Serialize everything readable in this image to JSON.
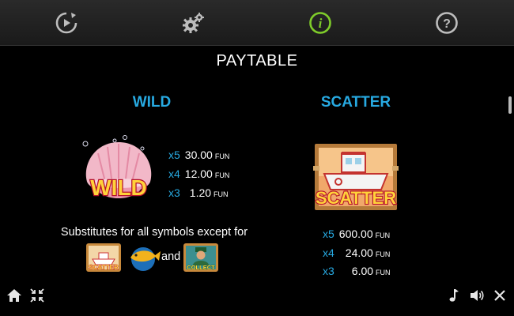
{
  "tabs": [
    {
      "name": "autoplay-icon",
      "active": false
    },
    {
      "name": "settings-icon",
      "active": false
    },
    {
      "name": "info-icon",
      "active": true
    },
    {
      "name": "help-icon",
      "active": false
    }
  ],
  "page_title": "PAYTABLE",
  "wild": {
    "heading": "WILD",
    "symbol_text": "WILD",
    "pays": [
      {
        "mult": "x5",
        "amount": "30.00",
        "currency": "FUN"
      },
      {
        "mult": "x4",
        "amount": "12.00",
        "currency": "FUN"
      },
      {
        "mult": "x3",
        "amount": "1.20",
        "currency": "FUN"
      }
    ],
    "substitutes_text": "Substitutes for all symbols except for",
    "and_text": "and",
    "mini_scatter_text": "SCATTER",
    "mini_collect_text": "COLLECT"
  },
  "scatter": {
    "heading": "SCATTER",
    "symbol_text": "SCATTER",
    "pays": [
      {
        "mult": "x5",
        "amount": "600.00",
        "currency": "FUN"
      },
      {
        "mult": "x4",
        "amount": "24.00",
        "currency": "FUN"
      },
      {
        "mult": "x3",
        "amount": "6.00",
        "currency": "FUN"
      }
    ]
  },
  "colors": {
    "accent_blue": "#27a9e1",
    "active_tab": "#7fcc2a",
    "inactive_tab": "#bdbdbd"
  },
  "bottom_bar": {
    "left": [
      "home-icon",
      "collapse-icon"
    ],
    "right": [
      "music-icon",
      "sound-icon",
      "close-icon"
    ]
  }
}
